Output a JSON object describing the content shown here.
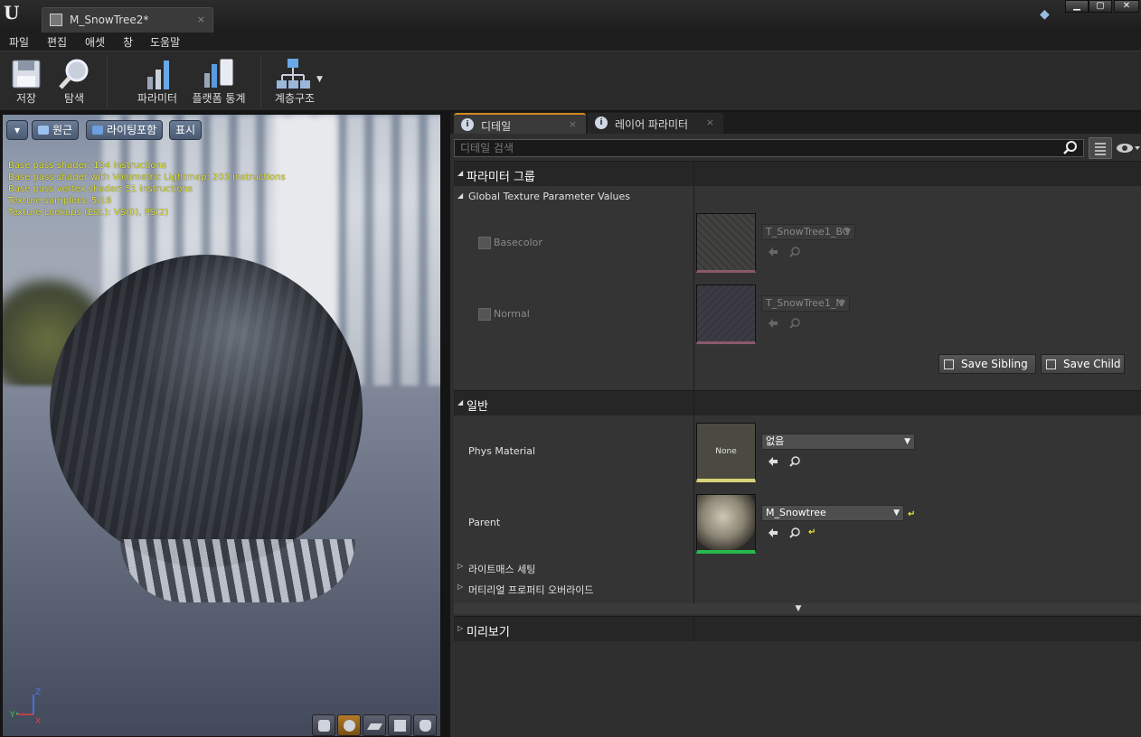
{
  "titlebar": {
    "doc_tab": "M_SnowTree2*",
    "tab_close": "×"
  },
  "menubar": {
    "items": [
      "파일",
      "편집",
      "애셋",
      "창",
      "도움말"
    ]
  },
  "toolbar": {
    "save": "저장",
    "browse": "탐색",
    "parameters": "파라미터",
    "platform_stats": "플랫폼 통계",
    "hierarchy": "계층구조"
  },
  "viewport": {
    "btn_perspective": "원근",
    "btn_lit": "라이팅포함",
    "btn_show": "표시",
    "stats": [
      "Base pass shader: 134 instructions",
      "Base pass shader with Volumetric Lightmap: 203 instructions",
      "Base pass vertex shader: 51 instructions",
      "Texture samplers: 5/16",
      "Texture Lookups (Est.): VS(0), PS(2)"
    ],
    "axis": {
      "z": "Z",
      "y": "Y",
      "x": "X"
    }
  },
  "details": {
    "tabs": [
      {
        "label": "디테일",
        "active": true
      },
      {
        "label": "레이어 파라미터",
        "active": false
      }
    ],
    "search_placeholder": "디테일 검색",
    "sections": {
      "param_group": "파라미터 그룹",
      "global_texture": "Global Texture Parameter Values",
      "general": "일반",
      "lightmass": "라이트매스 세팅",
      "material_override": "머티리얼 프로퍼티 오버라이드",
      "preview": "미리보기"
    },
    "params": {
      "basecolor": {
        "label": "Basecolor",
        "texture": "T_SnowTree1_BC"
      },
      "normal": {
        "label": "Normal",
        "texture": "T_SnowTree1_N"
      }
    },
    "save_sibling": "Save Sibling",
    "save_child": "Save Child",
    "phys_material": {
      "label": "Phys Material",
      "thumb": "None",
      "value": "없음"
    },
    "parent": {
      "label": "Parent",
      "value": "M_Snowtree"
    }
  },
  "colors": {
    "accent_yellow": "#e8e83a",
    "parent_green": "#29b84a",
    "phys_yellow": "#d8d47a",
    "tab_active_orange": "#d08a20"
  }
}
